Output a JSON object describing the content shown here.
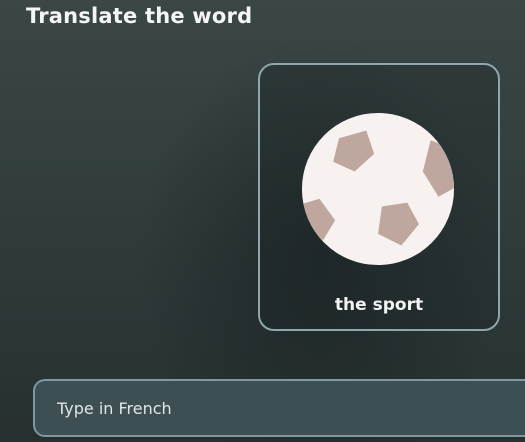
{
  "exercise": {
    "prompt": "Translate the word"
  },
  "card": {
    "image_icon": "soccer-ball-icon",
    "word": "the sport"
  },
  "answer": {
    "value": "",
    "placeholder": "Type in French"
  },
  "colors": {
    "background": "#2f3a3b",
    "card_border": "#8fa7ac",
    "input_background": "#3e4f53",
    "ball_white": "#f7f2ef",
    "ball_patch": "#bfa79f"
  }
}
